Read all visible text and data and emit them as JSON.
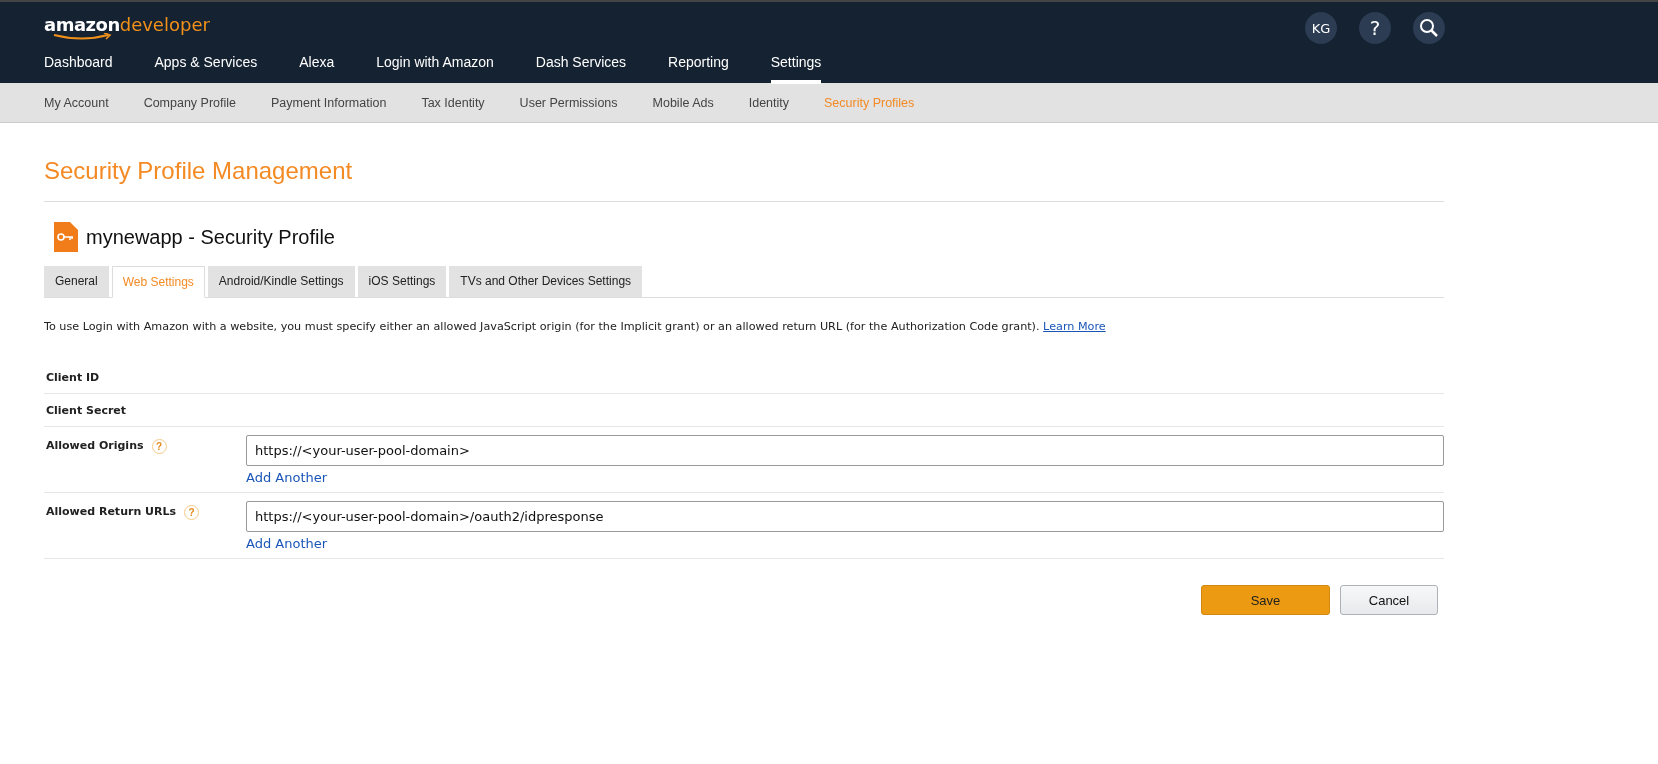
{
  "logo": {
    "brand": "amazon",
    "product": "developer"
  },
  "user": {
    "initials": "KG"
  },
  "help": {
    "label": "?"
  },
  "main_nav": [
    {
      "label": "Dashboard",
      "selected": false
    },
    {
      "label": "Apps & Services",
      "selected": false
    },
    {
      "label": "Alexa",
      "selected": false
    },
    {
      "label": "Login with Amazon",
      "selected": false
    },
    {
      "label": "Dash Services",
      "selected": false
    },
    {
      "label": "Reporting",
      "selected": false
    },
    {
      "label": "Settings",
      "selected": true
    }
  ],
  "sub_nav": [
    {
      "label": "My Account",
      "selected": false
    },
    {
      "label": "Company Profile",
      "selected": false
    },
    {
      "label": "Payment Information",
      "selected": false
    },
    {
      "label": "Tax Identity",
      "selected": false
    },
    {
      "label": "User Permissions",
      "selected": false
    },
    {
      "label": "Mobile Ads",
      "selected": false
    },
    {
      "label": "Identity",
      "selected": false
    },
    {
      "label": "Security Profiles",
      "selected": true
    }
  ],
  "page_title": "Security Profile Management",
  "profile_title": "mynewapp - Security Profile",
  "tabs": [
    {
      "label": "General",
      "selected": false
    },
    {
      "label": "Web Settings",
      "selected": true
    },
    {
      "label": "Android/Kindle Settings",
      "selected": false
    },
    {
      "label": "iOS Settings",
      "selected": false
    },
    {
      "label": "TVs and Other Devices Settings",
      "selected": false
    }
  ],
  "description": {
    "text": "To use Login with Amazon with a website, you must specify either an allowed JavaScript origin (for the Implicit grant) or an allowed return URL (for the Authorization Code grant).",
    "link": "Learn More"
  },
  "fields": [
    {
      "kind": "static",
      "label": "Client ID"
    },
    {
      "kind": "static",
      "label": "Client Secret"
    },
    {
      "kind": "input",
      "label": "Allowed Origins",
      "help": "?",
      "value": "https://<your-user-pool-domain>",
      "add_link": "Add Another"
    },
    {
      "kind": "input",
      "label": "Allowed Return URLs",
      "help": "?",
      "value": "https://<your-user-pool-domain>/oauth2/idpresponse",
      "add_link": "Add Another"
    }
  ],
  "buttons": [
    {
      "kind": "primary",
      "label": "Save"
    },
    {
      "kind": "secondary",
      "label": "Cancel"
    }
  ]
}
